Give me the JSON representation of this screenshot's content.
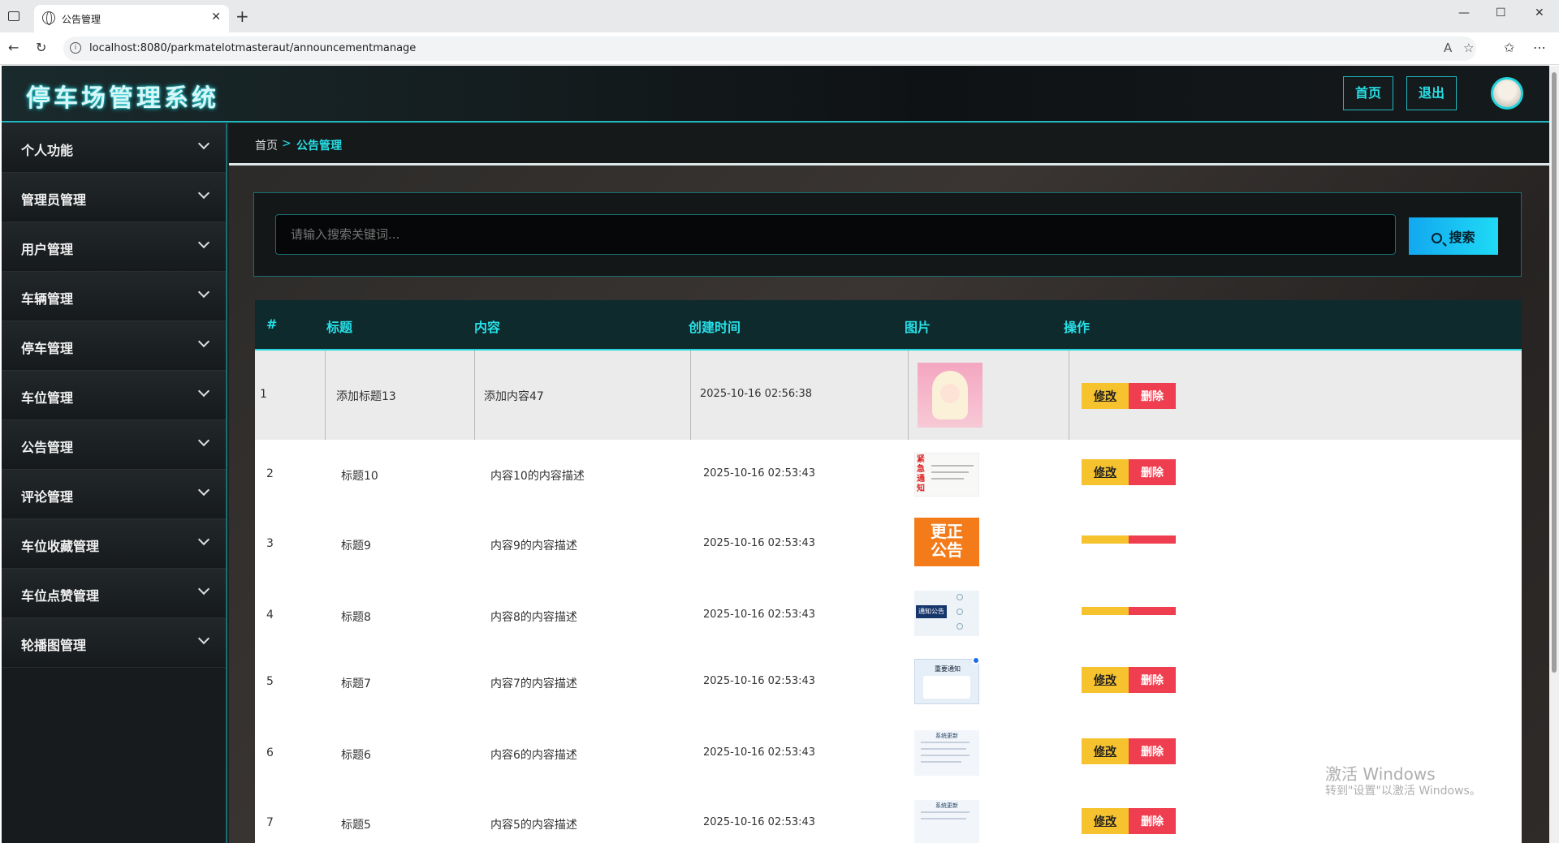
{
  "browser": {
    "tab_title": "公告管理",
    "url": "localhost:8080/parkmatelotmasteraut/announcementmanage"
  },
  "app": {
    "title": "停车场管理系统",
    "nav_home": "首页",
    "nav_logout": "退出"
  },
  "sidebar": {
    "items": [
      {
        "label": "个人功能"
      },
      {
        "label": "管理员管理"
      },
      {
        "label": "用户管理"
      },
      {
        "label": "车辆管理"
      },
      {
        "label": "停车管理"
      },
      {
        "label": "车位管理"
      },
      {
        "label": "公告管理"
      },
      {
        "label": "评论管理"
      },
      {
        "label": "车位收藏管理"
      },
      {
        "label": "车位点赞管理"
      },
      {
        "label": "轮播图管理"
      }
    ]
  },
  "breadcrumb": {
    "home": "首页",
    "separator": ">",
    "current": "公告管理"
  },
  "search": {
    "placeholder": "请输入搜索关键词...",
    "button": "搜索"
  },
  "table": {
    "headers": [
      "#",
      "标题",
      "内容",
      "创建时间",
      "图片",
      "操作"
    ],
    "edit_label": "修改",
    "delete_label": "删除",
    "rows": [
      {
        "id": "1",
        "title": "添加标题13",
        "content": "添加内容47",
        "time": "2025-10-16 02:56:38",
        "image": "anime-girl"
      },
      {
        "id": "2",
        "title": "标题10",
        "content": "内容10的内容描述",
        "time": "2025-10-16 02:53:43",
        "image": "urgent-notice"
      },
      {
        "id": "3",
        "title": "标题9",
        "content": "内容9的内容描述",
        "time": "2025-10-16 02:53:43",
        "image": "correction-notice"
      },
      {
        "id": "4",
        "title": "标题8",
        "content": "内容8的内容描述",
        "time": "2025-10-16 02:53:43",
        "image": "notice-announcement"
      },
      {
        "id": "5",
        "title": "标题7",
        "content": "内容7的内容描述",
        "time": "2025-10-16 02:53:43",
        "image": "important-notice"
      },
      {
        "id": "6",
        "title": "标题6",
        "content": "内容6的内容描述",
        "time": "2025-10-16 02:53:43",
        "image": "system-update"
      },
      {
        "id": "7",
        "title": "标题5",
        "content": "内容5的内容描述",
        "time": "2025-10-16 02:53:43",
        "image": "system-update"
      }
    ]
  },
  "thumb_text": {
    "urgent": "紧急通知",
    "correction": "更正公告",
    "notice": "通知公告",
    "important": "重要通知",
    "system": "系统更新"
  },
  "watermark": {
    "line1": "激活 Windows",
    "line2": "转到\"设置\"以激活 Windows。"
  },
  "colors": {
    "accent": "#27e0e8",
    "edit": "#f6c22d",
    "delete": "#ef3e4f"
  }
}
